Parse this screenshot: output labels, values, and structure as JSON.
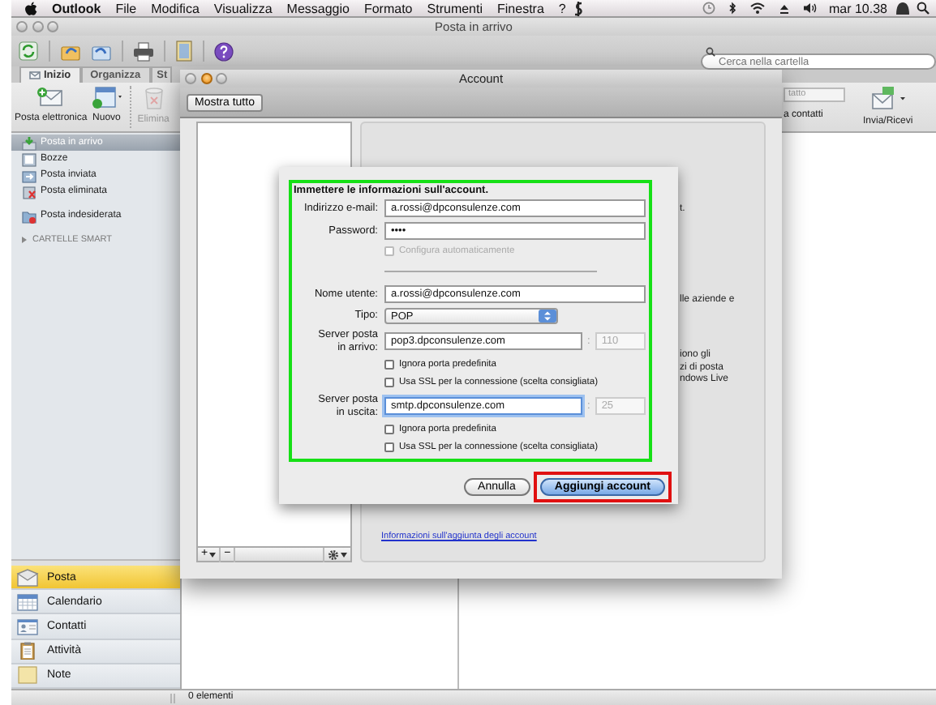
{
  "menubar": {
    "app": "Outlook",
    "items": [
      "File",
      "Modifica",
      "Visualizza",
      "Messaggio",
      "Formato",
      "Strumenti",
      "Finestra",
      "?"
    ],
    "clock": "mar 10.38"
  },
  "window": {
    "title": "Posta in arrivo"
  },
  "search": {
    "placeholder": "Cerca nella cartella"
  },
  "ribbon": {
    "tabs": [
      {
        "label": "Inizio",
        "selected": true
      },
      {
        "label": "Organizza",
        "selected": false
      },
      {
        "label": "St",
        "selected": false
      }
    ],
    "buttons": [
      {
        "label": "Posta elettronica",
        "disabled": false
      },
      {
        "label": "Nuovo",
        "disabled": false
      },
      {
        "label": "Elimina",
        "disabled": true
      }
    ],
    "contact_field": "tatto",
    "contact_label": "a contatti",
    "send_receive": "Invia/Ricevi"
  },
  "folders": [
    {
      "label": "Posta in arrivo",
      "selected": true
    },
    {
      "label": "Bozze",
      "selected": false
    },
    {
      "label": "Posta inviata",
      "selected": false
    },
    {
      "label": "Posta eliminata",
      "selected": false
    },
    {
      "label": "Posta indesiderata",
      "selected": false
    }
  ],
  "smart_folders": {
    "label": "CARTELLE SMART",
    "expanded": false
  },
  "nav": [
    {
      "label": "Posta",
      "selected": true
    },
    {
      "label": "Calendario",
      "selected": false
    },
    {
      "label": "Contatti",
      "selected": false
    },
    {
      "label": "Attività",
      "selected": false
    },
    {
      "label": "Note",
      "selected": false
    }
  ],
  "status_bar": "0 elementi",
  "account_window": {
    "title": "Account",
    "show_all": "Mostra tutto",
    "list_buttons": [
      "+",
      "−"
    ],
    "link": "Informazioni sull'aggiunta degli account",
    "background_fragments": [
      "t.",
      "lle aziende e",
      "iono gli\nzi di posta\nndows Live"
    ]
  },
  "sheet": {
    "heading": "Immettere le informazioni sull'account.",
    "rows": [
      {
        "kind": "text",
        "label": "Indirizzo e-mail:",
        "value": "a.rossi@dpconsulenze.com"
      },
      {
        "kind": "text",
        "label": "Password:",
        "value": "••••"
      },
      {
        "kind": "checkbox",
        "label": "Configura automaticamente",
        "checked": false,
        "disabled": true
      },
      {
        "kind": "separator"
      },
      {
        "kind": "text",
        "label": "Nome utente:",
        "value": "a.rossi@dpconsulenze.com"
      },
      {
        "kind": "select",
        "label": "Tipo:",
        "value": "POP"
      },
      {
        "kind": "server",
        "label": "Server posta\nin arrivo:",
        "value": "pop3.dpconsulenze.com",
        "port_label": ":",
        "port_placeholder": "110",
        "focused": false
      },
      {
        "kind": "checkbox",
        "label": "Ignora porta predefinita",
        "checked": false,
        "disabled": false
      },
      {
        "kind": "checkbox",
        "label": "Usa SSL per la connessione (scelta consigliata)",
        "checked": false,
        "disabled": false
      },
      {
        "kind": "server",
        "label": "Server posta\nin uscita:",
        "value": "smtp.dpconsulenze.com",
        "port_label": ":",
        "port_placeholder": "25",
        "focused": true
      },
      {
        "kind": "checkbox",
        "label": "Ignora porta predefinita",
        "checked": false,
        "disabled": false
      },
      {
        "kind": "checkbox",
        "label": "Usa SSL per la connessione (scelta consigliata)",
        "checked": false,
        "disabled": false
      }
    ],
    "buttons": [
      {
        "label": "Annulla",
        "default": false
      },
      {
        "label": "Aggiungi account",
        "default": true
      }
    ]
  }
}
